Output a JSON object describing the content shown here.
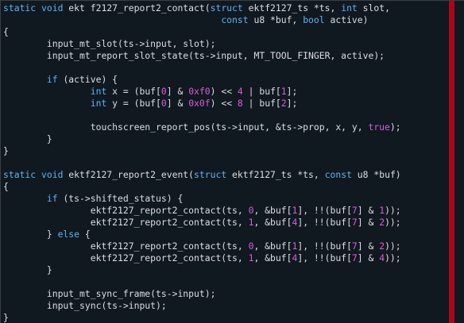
{
  "editor": {
    "language": "c",
    "colors": {
      "background": "#101820",
      "text": "#dcdfe4",
      "keyword": "#5fb3f0",
      "number": "#d75fd7",
      "ruler": "#a8071a"
    },
    "lines": [
      [
        [
          "kw",
          "static void"
        ],
        [
          "txt",
          " ekt f2127_report2_contact("
        ],
        [
          "kw",
          "struct"
        ],
        [
          "txt",
          " ektf2127_ts *ts, "
        ],
        [
          "kw",
          "int"
        ],
        [
          "txt",
          " slot,"
        ]
      ],
      [
        [
          "txt",
          "                                        "
        ],
        [
          "kw",
          "const"
        ],
        [
          "txt",
          " u8 *buf, "
        ],
        [
          "kw",
          "bool"
        ],
        [
          "txt",
          " active)"
        ]
      ],
      [
        [
          "txt",
          "{"
        ]
      ],
      [
        [
          "txt",
          "        input_mt_slot(ts->input, slot);"
        ]
      ],
      [
        [
          "txt",
          "        input_mt_report_slot_state(ts->input, MT_TOOL_FINGER, active);"
        ]
      ],
      [
        [
          "txt",
          ""
        ]
      ],
      [
        [
          "txt",
          "        "
        ],
        [
          "kw",
          "if"
        ],
        [
          "txt",
          " (active) {"
        ]
      ],
      [
        [
          "txt",
          "                "
        ],
        [
          "kw",
          "int"
        ],
        [
          "txt",
          " x = (buf["
        ],
        [
          "num",
          "0"
        ],
        [
          "txt",
          "] & "
        ],
        [
          "num",
          "0xf0"
        ],
        [
          "txt",
          ") << "
        ],
        [
          "num",
          "4"
        ],
        [
          "txt",
          " | buf["
        ],
        [
          "num",
          "1"
        ],
        [
          "txt",
          "];"
        ]
      ],
      [
        [
          "txt",
          "                "
        ],
        [
          "kw",
          "int"
        ],
        [
          "txt",
          " y = (buf["
        ],
        [
          "num",
          "0"
        ],
        [
          "txt",
          "] & "
        ],
        [
          "num",
          "0x0f"
        ],
        [
          "txt",
          ") << "
        ],
        [
          "num",
          "8"
        ],
        [
          "txt",
          " | buf["
        ],
        [
          "num",
          "2"
        ],
        [
          "txt",
          "];"
        ]
      ],
      [
        [
          "txt",
          ""
        ]
      ],
      [
        [
          "txt",
          "                touchscreen_report_pos(ts->input, &ts->prop, x, y, "
        ],
        [
          "num",
          "true"
        ],
        [
          "txt",
          ");"
        ]
      ],
      [
        [
          "txt",
          "        }"
        ]
      ],
      [
        [
          "txt",
          "}"
        ]
      ],
      [
        [
          "txt",
          ""
        ]
      ],
      [
        [
          "kw",
          "static void"
        ],
        [
          "txt",
          " ektf2127_report2_event("
        ],
        [
          "kw",
          "struct"
        ],
        [
          "txt",
          " ektf2127_ts *ts, "
        ],
        [
          "kw",
          "const"
        ],
        [
          "txt",
          " u8 *buf)"
        ]
      ],
      [
        [
          "txt",
          "{"
        ]
      ],
      [
        [
          "txt",
          "        "
        ],
        [
          "kw",
          "if"
        ],
        [
          "txt",
          " (ts->shifted_status) {"
        ]
      ],
      [
        [
          "txt",
          "                ektf2127_report2_contact(ts, "
        ],
        [
          "num",
          "0"
        ],
        [
          "txt",
          ", &buf["
        ],
        [
          "num",
          "1"
        ],
        [
          "txt",
          "], !!(buf["
        ],
        [
          "num",
          "7"
        ],
        [
          "txt",
          "] & "
        ],
        [
          "num",
          "1"
        ],
        [
          "txt",
          "));"
        ]
      ],
      [
        [
          "txt",
          "                ektf2127_report2_contact(ts, "
        ],
        [
          "num",
          "1"
        ],
        [
          "txt",
          ", &buf["
        ],
        [
          "num",
          "4"
        ],
        [
          "txt",
          "], !!(buf["
        ],
        [
          "num",
          "7"
        ],
        [
          "txt",
          "] & "
        ],
        [
          "num",
          "2"
        ],
        [
          "txt",
          "));"
        ]
      ],
      [
        [
          "txt",
          "        } "
        ],
        [
          "kw",
          "else"
        ],
        [
          "txt",
          " {"
        ]
      ],
      [
        [
          "txt",
          "                ektf2127_report2_contact(ts, "
        ],
        [
          "num",
          "0"
        ],
        [
          "txt",
          ", &buf["
        ],
        [
          "num",
          "1"
        ],
        [
          "txt",
          "], !!(buf["
        ],
        [
          "num",
          "7"
        ],
        [
          "txt",
          "] & "
        ],
        [
          "num",
          "2"
        ],
        [
          "txt",
          "));"
        ]
      ],
      [
        [
          "txt",
          "                ektf2127_report2_contact(ts, "
        ],
        [
          "num",
          "1"
        ],
        [
          "txt",
          ", &buf["
        ],
        [
          "num",
          "4"
        ],
        [
          "txt",
          "], !!(buf["
        ],
        [
          "num",
          "7"
        ],
        [
          "txt",
          "] & "
        ],
        [
          "num",
          "4"
        ],
        [
          "txt",
          "));"
        ]
      ],
      [
        [
          "txt",
          "        }"
        ]
      ],
      [
        [
          "txt",
          ""
        ]
      ],
      [
        [
          "txt",
          "        input_mt_sync_frame(ts->input);"
        ]
      ],
      [
        [
          "txt",
          "        input_sync(ts->input);"
        ]
      ],
      [
        [
          "txt",
          "}"
        ]
      ]
    ]
  }
}
